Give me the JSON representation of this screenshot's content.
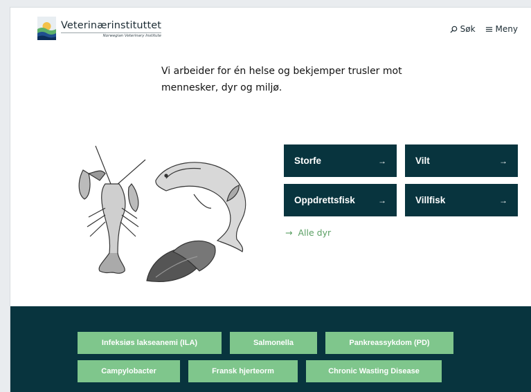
{
  "header": {
    "logo_name": "Veterinærinstituttet",
    "logo_sub": "Norwegian Veterinary Institute",
    "search_label": "Søk",
    "menu_label": "Meny"
  },
  "intro": {
    "line1": "Vi arbeider for én helse og bekjemper trusler mot",
    "line2": "mennesker, dyr og miljø."
  },
  "animals": [
    {
      "label": "Storfe",
      "arrow": "→"
    },
    {
      "label": "Vilt",
      "arrow": "→"
    },
    {
      "label": "Oppdrettsfisk",
      "arrow": "→"
    },
    {
      "label": "Villfisk",
      "arrow": "→"
    }
  ],
  "all_animals": {
    "arrow": "→",
    "label": "Alle dyr"
  },
  "diseases": [
    "Infeksiøs lakseanemi (ILA)",
    "Salmonella",
    "Pankreassykdom (PD)",
    "Campylobacter",
    "Fransk hjerteorm",
    "Chronic Wasting Disease"
  ],
  "colors": {
    "primary_dark": "#08343e",
    "accent_green": "#7fc68c",
    "link_green": "#5a9f63"
  }
}
